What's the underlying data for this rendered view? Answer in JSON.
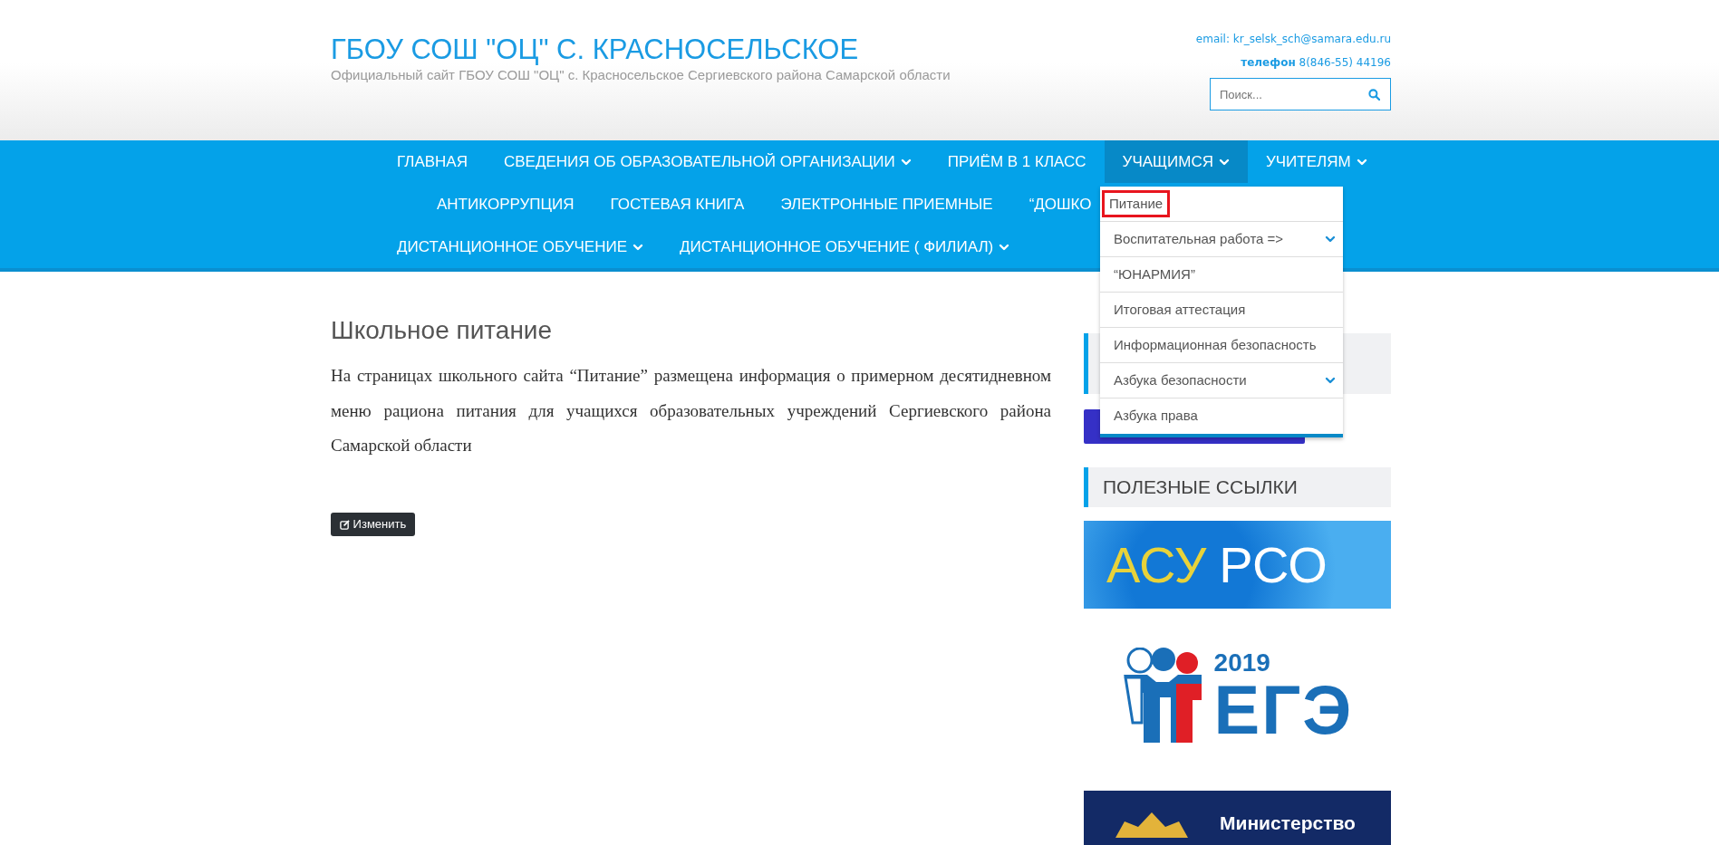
{
  "header": {
    "title": "ГБОУ СОШ \"ОЦ\" С. КРАСНОСЕЛЬСКОЕ",
    "subtitle": "Официальный сайт ГБОУ СОШ \"ОЦ\" с. Красносельское Сергиевского района Самарской области",
    "email_label": "email:",
    "email": "kr_selsk_sch@samara.edu.ru",
    "phone_label": "телефон",
    "phone": "8(846-55) 44196",
    "search": {
      "placeholder": "Поиск..."
    }
  },
  "nav": {
    "lines": [
      {
        "items": [
          {
            "label": "ГЛАВНАЯ",
            "has_submenu": false,
            "selected": false
          },
          {
            "label": "СВЕДЕНИЯ ОБ ОБРАЗОВАТЕЛЬНОЙ ОРГАНИЗАЦИИ",
            "has_submenu": true,
            "selected": false
          },
          {
            "label": "ПРИЁМ В 1 КЛАСС",
            "has_submenu": false,
            "selected": false
          },
          {
            "label": "УЧАЩИМСЯ",
            "has_submenu": true,
            "selected": true
          },
          {
            "label": "УЧИТЕЛЯМ",
            "has_submenu": true,
            "selected": false
          }
        ]
      },
      {
        "items": [
          {
            "label": "АНТИКОРРУПЦИЯ",
            "has_submenu": false,
            "selected": false
          },
          {
            "label": "ГОСТЕВАЯ КНИГА",
            "has_submenu": false,
            "selected": false
          },
          {
            "label": "ЭЛЕКТРОННЫЕ ПРИЕМНЫЕ",
            "has_submenu": false,
            "selected": false
          },
          {
            "label": "“ДОШКО",
            "has_submenu": false,
            "selected": false
          }
        ]
      },
      {
        "items": [
          {
            "label": "ДИСТАНЦИОННОЕ ОБУЧЕНИЕ",
            "has_submenu": true,
            "selected": false
          },
          {
            "label": "ДИСТАНЦИОННОЕ ОБУЧЕНИЕ ( ФИЛИАЛ)",
            "has_submenu": true,
            "selected": false
          }
        ]
      }
    ]
  },
  "dropdown": [
    {
      "label": "Питание",
      "has_submenu": false,
      "outlined": true
    },
    {
      "label": "Воспитательная работа =>",
      "has_submenu": true,
      "outlined": false
    },
    {
      "label": "“ЮНАРМИЯ”",
      "has_submenu": false,
      "outlined": false
    },
    {
      "label": "Итоговая аттестация",
      "has_submenu": false,
      "outlined": false
    },
    {
      "label": "Информационная безопасность",
      "has_submenu": false,
      "outlined": false
    },
    {
      "label": "Азбука безопасности",
      "has_submenu": true,
      "outlined": false
    },
    {
      "label": "Азбука права",
      "has_submenu": false,
      "outlined": false
    }
  ],
  "article": {
    "title": "Школьное питание",
    "text_before": "На страницах школьного сайта “",
    "link": "Питание",
    "text_after": "”  размещена информация о примерном десятидневном меню рациона питания для учащихся образовательных учреждений Сергиевского района Самарской области",
    "edit_button": "Изменить"
  },
  "sidebar": {
    "links_title": "ПОЛЕЗНЫЕ ССЫЛКИ",
    "banners": [
      {
        "kind": "asu",
        "text_1": "АСУ",
        "text_2": "РСО"
      },
      {
        "kind": "ege",
        "text_1": "2019",
        "text_2": "ЕГЭ"
      },
      {
        "kind": "ministry",
        "text_1": "Министерство"
      }
    ]
  }
}
